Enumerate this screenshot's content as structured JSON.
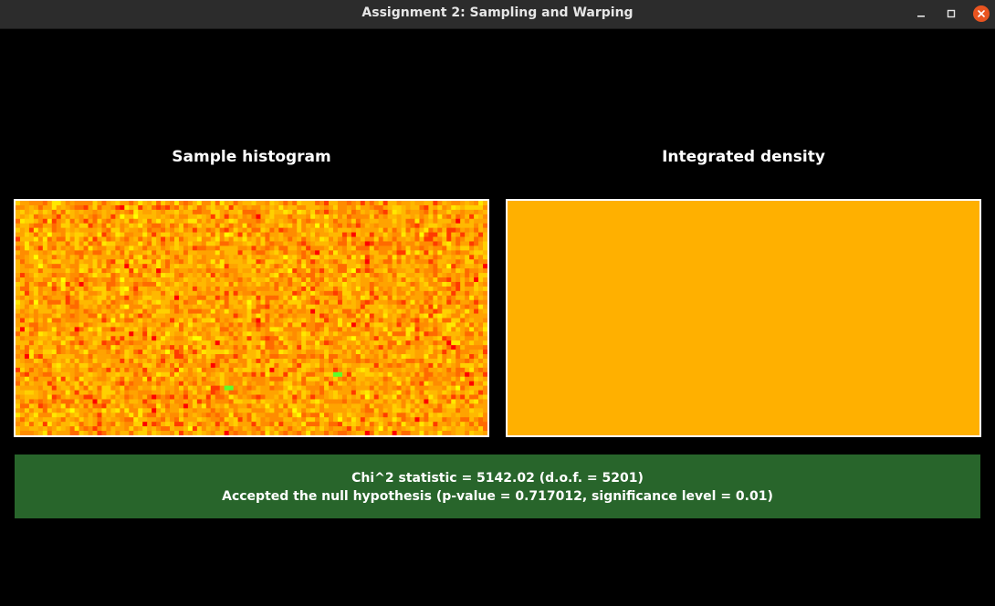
{
  "window": {
    "title": "Assignment 2: Sampling and Warping"
  },
  "panels": {
    "histogram_title": "Sample histogram",
    "density_title": "Integrated density",
    "density_color": "#ffb000"
  },
  "histogram": {
    "cols": 104,
    "rows": 52,
    "palette": [
      "#ff0000",
      "#ff3a00",
      "#ff6a00",
      "#ff8c00",
      "#ffa300",
      "#ffb800",
      "#ffd000",
      "#ffe800",
      "#ffff00"
    ],
    "highlight_color": "#5cff2a"
  },
  "status": {
    "line1": "Chi^2 statistic = 5142.02 (d.o.f. = 5201)",
    "line2": "Accepted the null hypothesis (p-value = 0.717012, significance level = 0.01)",
    "background": "#28652b"
  },
  "icons": {
    "minimize": "minimize-icon",
    "maximize": "maximize-icon",
    "close": "close-icon"
  }
}
